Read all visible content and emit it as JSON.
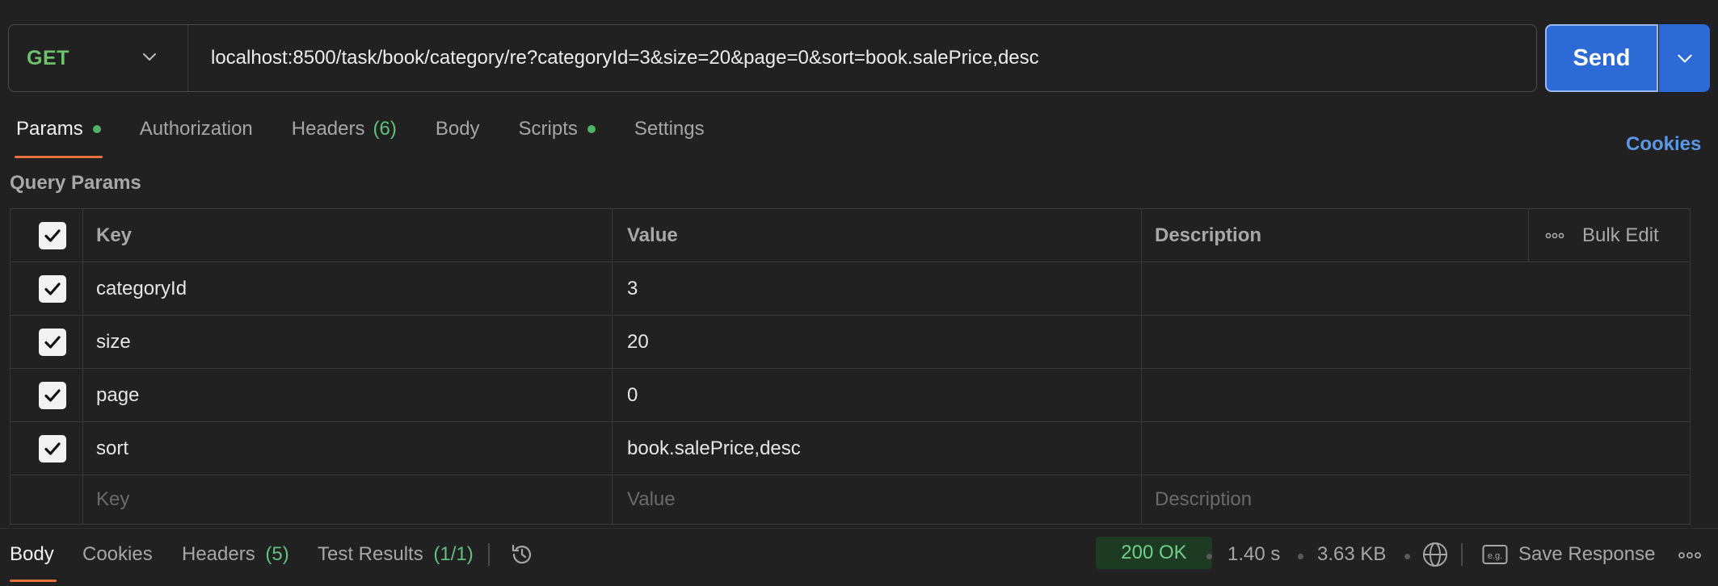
{
  "request": {
    "method": "GET",
    "url": "localhost:8500/task/book/category/re?categoryId=3&size=20&page=0&sort=book.salePrice,desc",
    "send_label": "Send"
  },
  "tabs": [
    {
      "label": "Params",
      "active": true,
      "dot": true
    },
    {
      "label": "Authorization"
    },
    {
      "label": "Headers",
      "count": "(6)"
    },
    {
      "label": "Body"
    },
    {
      "label": "Scripts",
      "dot": true
    },
    {
      "label": "Settings"
    }
  ],
  "cookies_link": "Cookies",
  "query_params": {
    "title": "Query Params",
    "headers": {
      "key": "Key",
      "value": "Value",
      "description": "Description",
      "bulk_edit": "Bulk Edit"
    },
    "rows": [
      {
        "key": "categoryId",
        "value": "3",
        "checked": true
      },
      {
        "key": "size",
        "value": "20",
        "checked": true
      },
      {
        "key": "page",
        "value": "0",
        "checked": true
      },
      {
        "key": "sort",
        "value": "book.salePrice,desc",
        "checked": true
      }
    ],
    "placeholders": {
      "key": "Key",
      "value": "Value",
      "description": "Description"
    }
  },
  "response_bar": {
    "tabs": [
      {
        "label": "Body",
        "active": true
      },
      {
        "label": "Cookies"
      },
      {
        "label": "Headers",
        "count": "(5)"
      },
      {
        "label": "Test Results",
        "count": "(1/1)"
      }
    ],
    "status": "200 OK",
    "time": "1.40 s",
    "size": "3.63 KB",
    "save_response": "Save Response"
  },
  "colors": {
    "method_get": "#6ec26b",
    "accent_orange": "#e8703a",
    "send_blue": "#2c6ad6",
    "status_green": "#6fd08a"
  },
  "icons": [
    "chevron-down-icon",
    "check-icon",
    "more-horizontal-icon",
    "history-icon",
    "globe-icon",
    "example-icon"
  ]
}
